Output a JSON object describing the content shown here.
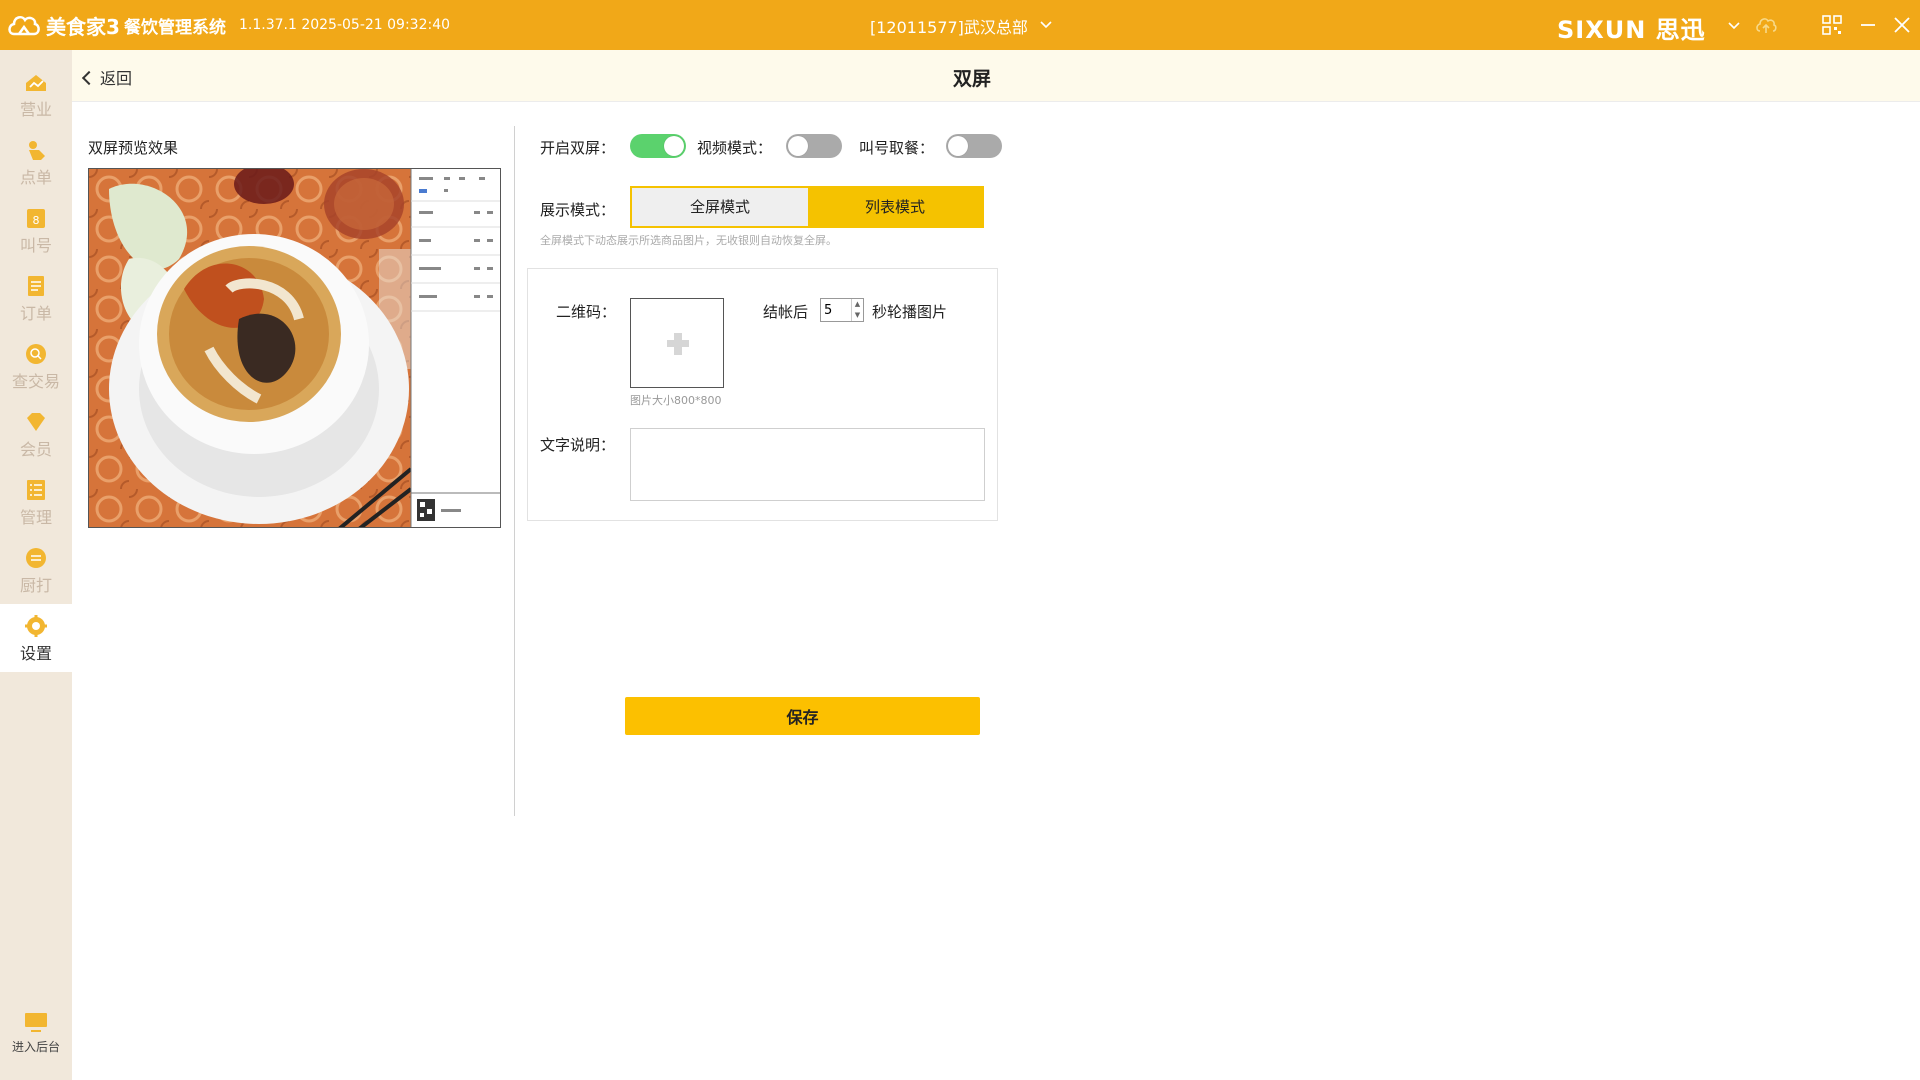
{
  "titlebar": {
    "brand": "美食家3",
    "system_name": "餐饮管理系统",
    "version": "1.1.37.1 2025-05-21 09:32:40",
    "store": "[12011577]武汉总部",
    "company": "SIXUN 思迅"
  },
  "sidebar": {
    "items": [
      {
        "label": "营业",
        "icon": "business-icon"
      },
      {
        "label": "点单",
        "icon": "order-icon"
      },
      {
        "label": "叫号",
        "icon": "call-number-icon"
      },
      {
        "label": "订单",
        "icon": "orders-icon"
      },
      {
        "label": "查交易",
        "icon": "transaction-search-icon"
      },
      {
        "label": "会员",
        "icon": "member-icon"
      },
      {
        "label": "管理",
        "icon": "management-icon"
      },
      {
        "label": "厨打",
        "icon": "kitchen-print-icon"
      },
      {
        "label": "设置",
        "icon": "settings-icon",
        "active": true
      }
    ],
    "backend": "进入后台"
  },
  "header": {
    "back": "返回",
    "title": "双屏"
  },
  "preview": {
    "label": "双屏预览效果"
  },
  "settings": {
    "enable_dual_label": "开启双屏：",
    "enable_dual_on": true,
    "video_mode_label": "视频模式：",
    "video_mode_on": false,
    "call_pickup_label": "叫号取餐：",
    "call_pickup_on": false,
    "display_mode_label": "展示模式：",
    "mode_fullscreen": "全屏模式",
    "mode_list": "列表模式",
    "selected_mode": "列表模式",
    "hint": "全屏模式下动态展示所选商品图片，无收银则自动恢复全屏。",
    "qrcode_label": "二维码：",
    "image_size_hint": "图片大小800*800",
    "after_checkout_label": "结帐后",
    "seconds_value": "5",
    "rotate_label": "秒轮播图片",
    "text_desc_label": "文字说明：",
    "text_desc_value": "",
    "save": "保存"
  },
  "colors": {
    "accent": "#f1a818",
    "button": "#fcc000",
    "toggle_on": "#5bd26d",
    "toggle_off": "#aaaaaa",
    "sidebar_bg": "#f1e8db"
  }
}
